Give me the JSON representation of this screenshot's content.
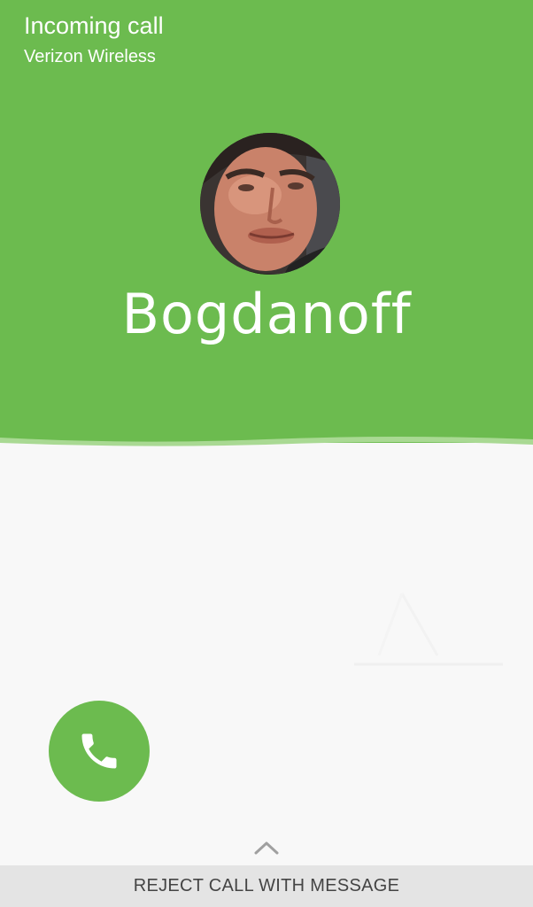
{
  "call": {
    "status": "Incoming call",
    "carrier": "Verizon Wireless",
    "caller_name": "Bogdanoff"
  },
  "actions": {
    "answer_icon": "phone-icon",
    "swipe_up_icon": "chevron-up-icon",
    "reject_with_message": "REJECT CALL WITH MESSAGE"
  },
  "colors": {
    "accent": "#6cbb4f",
    "background": "#f8f8f8",
    "reject_bar": "#e4e4e4",
    "reject_text": "#444444"
  }
}
